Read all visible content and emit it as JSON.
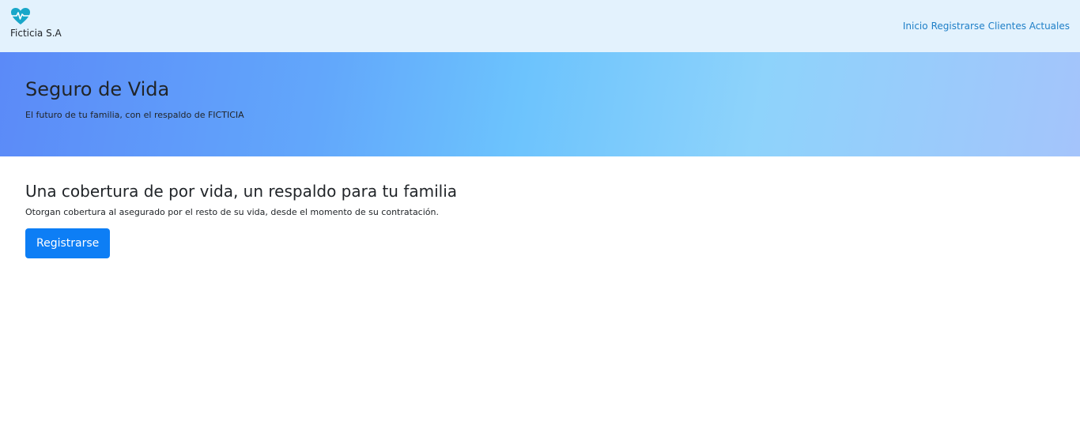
{
  "navbar": {
    "brand_name": "Ficticia S.A",
    "logo_icon": "heart-pulse-icon",
    "logo_color": "#19a7c9",
    "links": [
      {
        "label": "Inicio"
      },
      {
        "label": "Registrarse"
      },
      {
        "label": "Clientes Actuales"
      }
    ],
    "background_color": "#e3f2fd",
    "link_color": "#1e7fc7"
  },
  "hero": {
    "title": "Seguro de Vida",
    "subtitle": "El futuro de tu familia, con el respaldo de FICTICIA"
  },
  "main": {
    "heading": "Una cobertura de por vida, un respaldo para tu familia",
    "description": "Otorgan cobertura al asegurado por el resto de su vida, desde el momento de su contratación.",
    "cta_label": "Registrarse",
    "cta_color": "#0d7ef5"
  }
}
